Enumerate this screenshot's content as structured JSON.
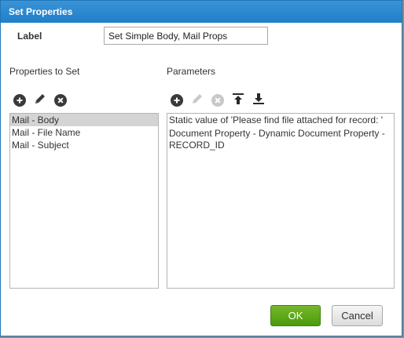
{
  "dialog": {
    "title": "Set Properties",
    "label_caption": "Label",
    "label_value": "Set Simple Body, Mail Props"
  },
  "properties": {
    "title": "Properties to Set",
    "toolbar": [
      "add-icon",
      "edit-icon",
      "remove-icon"
    ],
    "items": [
      {
        "label": "Mail - Body",
        "selected": true
      },
      {
        "label": "Mail - File Name",
        "selected": false
      },
      {
        "label": "Mail - Subject",
        "selected": false
      }
    ]
  },
  "parameters": {
    "title": "Parameters",
    "toolbar": [
      "add-icon",
      "edit-icon-disabled",
      "remove-icon-disabled",
      "move-to-top-icon",
      "move-to-bottom-icon"
    ],
    "items": [
      "Static value of 'Please find file attached for record: '",
      "Document Property - Dynamic Document Property - RECORD_ID"
    ]
  },
  "buttons": {
    "ok": "OK",
    "cancel": "Cancel"
  },
  "colors": {
    "title_bar": "#1f7fc8",
    "ok_button": "#5aa518",
    "selection": "#d4d4d4"
  }
}
